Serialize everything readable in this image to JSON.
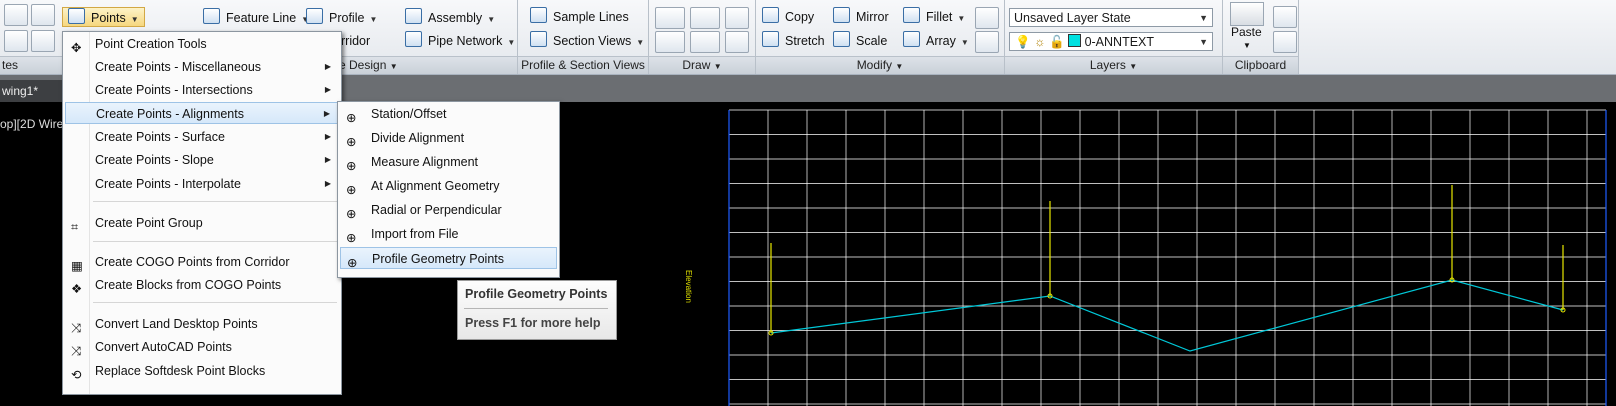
{
  "ribbon": {
    "points_label": "Points",
    "feature_line_label": "Feature Line",
    "profile_label": "Profile",
    "corridor_label": "rridor",
    "assembly_label": "Assembly",
    "pipe_network_label": "Pipe Network",
    "sample_lines_label": "Sample Lines",
    "section_views_label": "Section Views",
    "copy_label": "Copy",
    "mirror_label": "Mirror",
    "fillet_label": "Fillet",
    "stretch_label": "Stretch",
    "scale_label": "Scale",
    "array_label": "Array",
    "layer_state": "Unsaved Layer State",
    "current_layer": "0-ANNTEXT",
    "paste_label": "Paste",
    "panels": {
      "create": "tes",
      "design": "e Design",
      "profile_views": "Profile & Section Views",
      "draw": "Draw",
      "modify": "Modify",
      "layers": "Layers",
      "clipboard": "Clipboard"
    }
  },
  "document": {
    "tab_title": "wing1*",
    "viewport_label": "op][2D Wire"
  },
  "menu": {
    "items": [
      {
        "label": "Point Creation Tools"
      },
      {
        "label": "Create Points - Miscellaneous"
      },
      {
        "label": "Create Points - Intersections"
      },
      {
        "label": "Create Points - Alignments"
      },
      {
        "label": "Create Points - Surface"
      },
      {
        "label": "Create Points - Slope"
      },
      {
        "label": "Create Points - Interpolate"
      },
      {
        "label": "Create Point Group"
      },
      {
        "label": "Create COGO Points from Corridor"
      },
      {
        "label": "Create Blocks from COGO Points"
      },
      {
        "label": "Convert Land Desktop Points"
      },
      {
        "label": "Convert AutoCAD Points"
      },
      {
        "label": "Replace Softdesk Point Blocks"
      }
    ]
  },
  "submenu": {
    "items": [
      {
        "label": "Station/Offset"
      },
      {
        "label": "Divide Alignment"
      },
      {
        "label": "Measure Alignment"
      },
      {
        "label": "At Alignment Geometry"
      },
      {
        "label": "Radial or Perpendicular"
      },
      {
        "label": "Import from File"
      },
      {
        "label": "Profile Geometry Points"
      }
    ]
  },
  "tooltip": {
    "title": "Profile Geometry Points",
    "help": "Press F1 for more help"
  },
  "profile_view": {
    "y_axis_label": "Elevation"
  },
  "colors": {
    "grid": "#ffffff",
    "profile_line": "#00c8d8",
    "labels": "#e8e800",
    "axis": "#1e5cff"
  }
}
